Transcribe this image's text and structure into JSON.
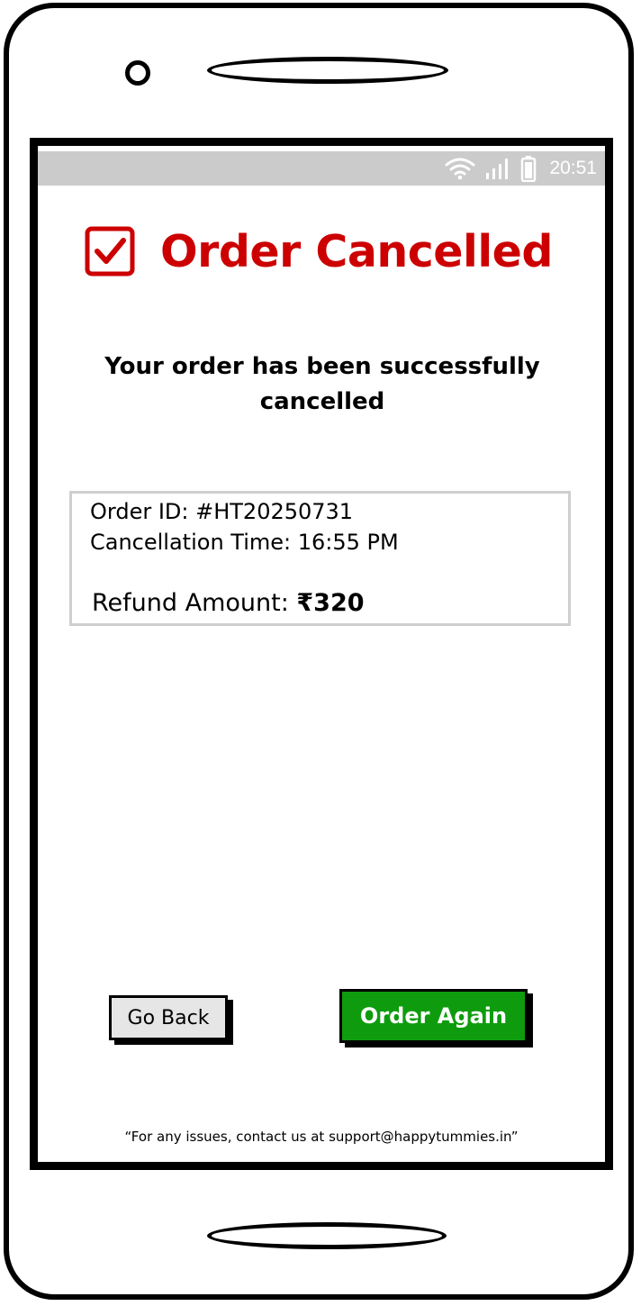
{
  "status_bar": {
    "time": "20:51",
    "icons": [
      "wifi-icon",
      "signal-icon",
      "battery-icon"
    ]
  },
  "header": {
    "title": "Order Cancelled",
    "icon": "checkbox-checked-icon",
    "accent_color": "#cc0000"
  },
  "message": "Your order has been successfully cancelled",
  "order_details": {
    "order_id_line": "Order ID: #HT20250731",
    "cancellation_time_line": "Cancellation Time: 16:55 PM",
    "refund_label": "Refund Amount: ",
    "refund_amount": "₹320"
  },
  "actions": {
    "go_back_label": "Go Back",
    "order_again_label": "Order Again",
    "order_again_color": "#0e9c0e",
    "go_back_color": "#e6e6e6"
  },
  "footer": {
    "support_note": "“For any issues, contact us at support@happytummies.in”"
  }
}
